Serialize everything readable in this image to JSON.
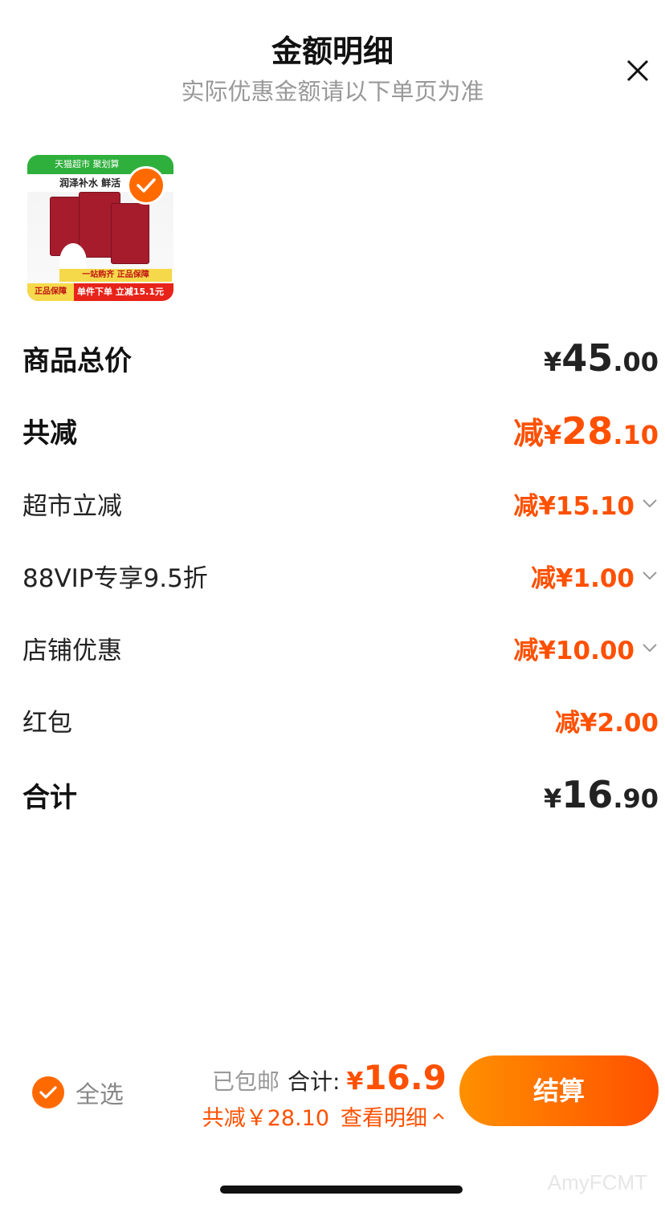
{
  "header": {
    "title": "金额明细",
    "subtitle": "实际优惠金额请以下单页为准"
  },
  "product": {
    "image_texts": {
      "top_banner": "天猫超市  聚划算",
      "slogan": "润泽补水 鲜活",
      "promo": "一站购齐 正品保障",
      "badge": "正品保障",
      "discount": "单件下单 立减15.1元"
    },
    "selected": true
  },
  "rows": {
    "subtotal": {
      "label": "商品总价",
      "currency": "¥",
      "int": "45",
      "dec": ".00"
    },
    "discount_total": {
      "label": "共减",
      "prefix": "减",
      "currency": "¥",
      "int": "28",
      "dec": ".10"
    },
    "market_discount": {
      "label": "超市立减",
      "amount": "减¥15.10"
    },
    "vip_discount": {
      "label": "88VIP专享9.5折",
      "amount": "减¥1.00"
    },
    "store_discount": {
      "label": "店铺优惠",
      "amount": "减¥10.00"
    },
    "red_packet": {
      "label": "红包",
      "amount": "减¥2.00"
    },
    "total": {
      "label": "合计",
      "currency": "¥",
      "int": "16",
      "dec": ".90"
    }
  },
  "bottom_bar": {
    "select_all": "全选",
    "shipping": "已包邮",
    "total_label": "合计:",
    "total_currency": "¥",
    "total_value": "16.9",
    "saved": "共减￥28.10",
    "detail_link": "查看明细",
    "checkout": "结算"
  },
  "watermark": "AmyFCMT",
  "colors": {
    "accent": "#ff5000",
    "checkout_start": "#ff9000",
    "checkout_end": "#ff5000"
  }
}
